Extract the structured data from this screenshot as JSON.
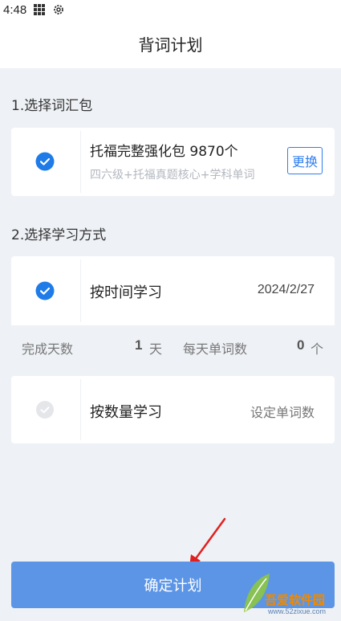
{
  "status_bar": {
    "time": "4:48",
    "icons": [
      "grid-icon",
      "gear-icon"
    ]
  },
  "header": {
    "title": "背词计划"
  },
  "section1": {
    "title": "1.选择词汇包",
    "package": {
      "name": "托福完整强化包 9870个",
      "description": "四六级+托福真题核心+学科单词",
      "change_label": "更换",
      "selected": true
    }
  },
  "section2": {
    "title": "2.选择学习方式",
    "by_time": {
      "label": "按时间学习",
      "value": "2024/2/27",
      "selected": true
    },
    "stats": {
      "days_label": "完成天数",
      "days_value": "1",
      "days_unit": "天",
      "daily_label": "每天单词数",
      "daily_value": "0",
      "daily_unit": "个"
    },
    "by_count": {
      "label": "按数量学习",
      "value": "设定单词数",
      "selected": false
    }
  },
  "confirm_button": {
    "label": "确定计划"
  },
  "watermark": {
    "text": "吾爱软件园",
    "url": "www.52zixue.com"
  },
  "colors": {
    "accent": "#2f7ff0",
    "button": "#5c95e6",
    "background": "#eef1f5",
    "check_active": "#1e7be8",
    "check_inactive": "#d8dbe0"
  }
}
